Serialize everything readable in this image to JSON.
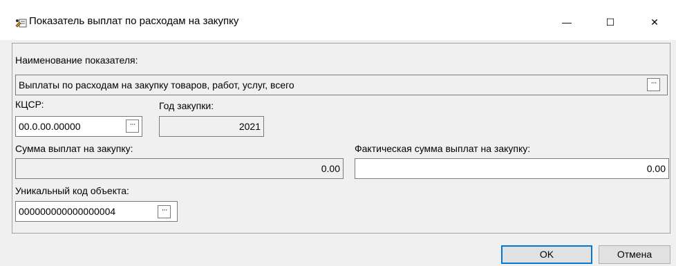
{
  "window": {
    "title": "Показатель выплат по расходам на закупку",
    "minimize_glyph": "—",
    "maximize_glyph": "☐",
    "close_glyph": "✕",
    "icon": "form-edit-icon"
  },
  "form": {
    "indicator_name_label": "Наименование показателя:",
    "indicator_name_value": "Выплаты по расходам на закупку товаров, работ, услуг, всего",
    "kcsr_label": "КЦСР:",
    "kcsr_value": "00.0.00.00000",
    "purchase_year_label": "Год закупки:",
    "purchase_year_value": "2021",
    "payment_sum_label": "Сумма выплат на закупку:",
    "payment_sum_value": "0.00",
    "actual_sum_label": "Фактическая сумма выплат на закупку:",
    "actual_sum_value": "0.00",
    "unique_code_label": "Уникальный код объекта:",
    "unique_code_value": "000000000000000004",
    "ellipsis": "···"
  },
  "buttons": {
    "ok": "OK",
    "cancel": "Отмена"
  }
}
